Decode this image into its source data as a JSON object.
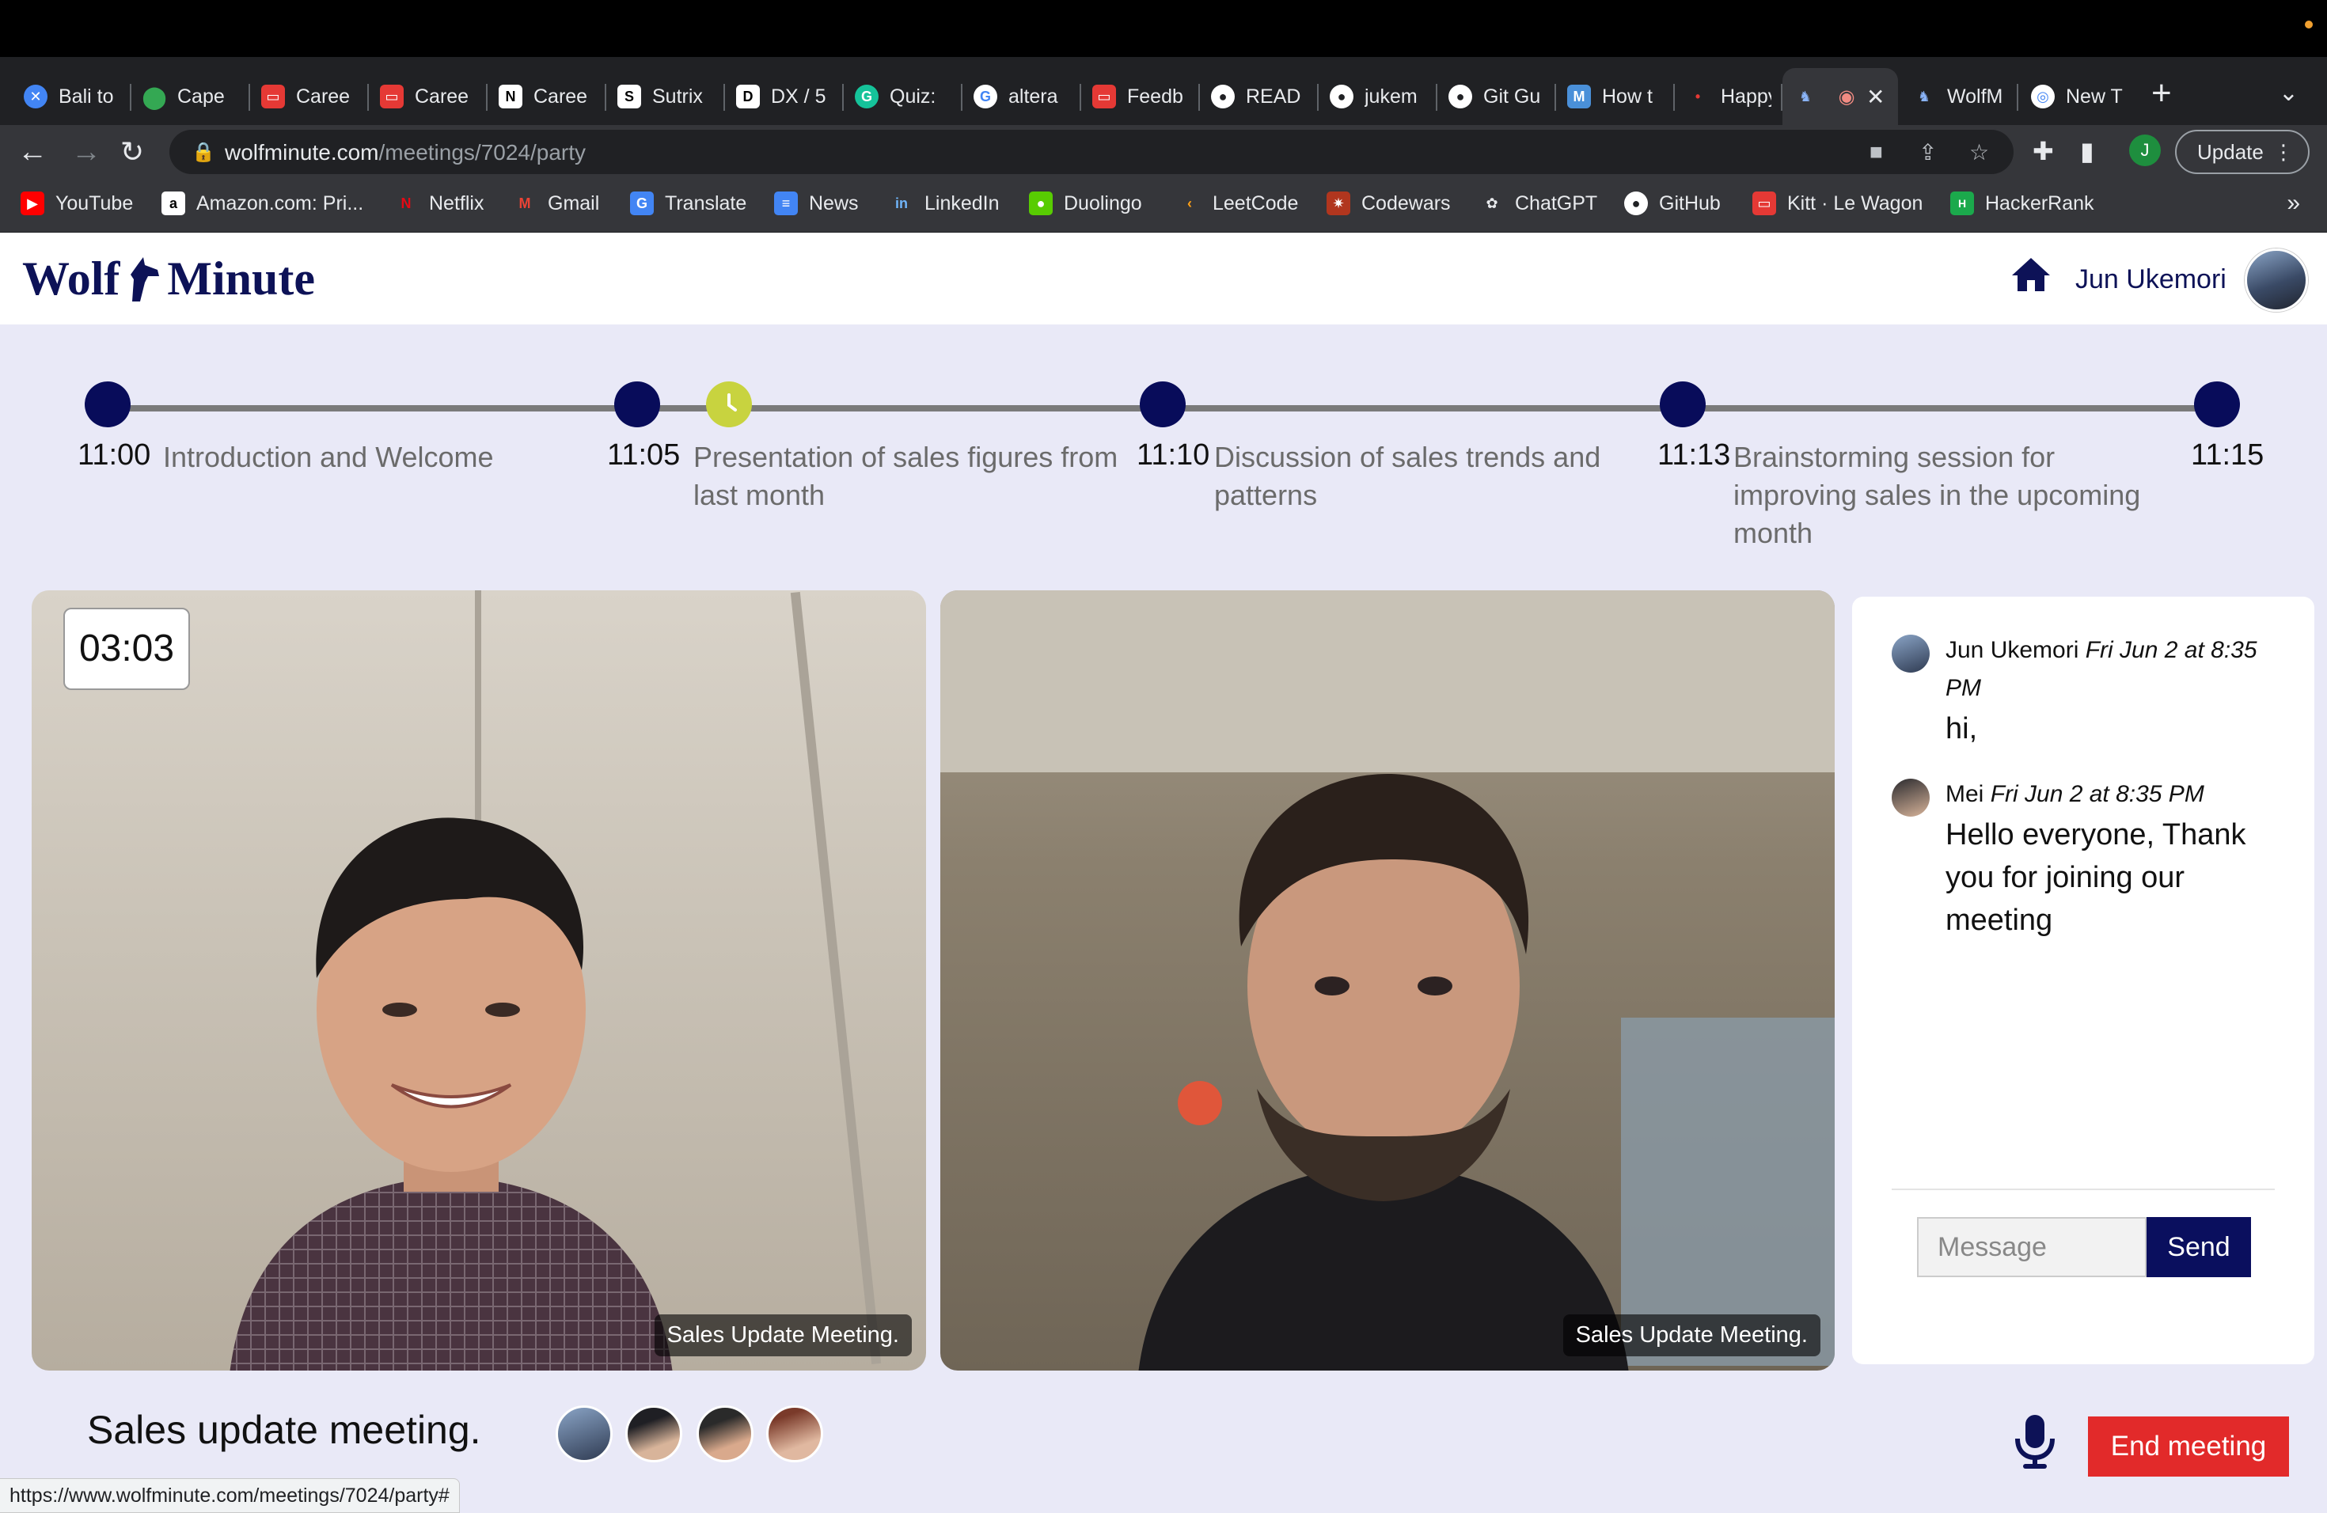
{
  "browser": {
    "tabs": [
      {
        "label": "Bali to",
        "favicon": "x-icon",
        "color": "#4285f4"
      },
      {
        "label": "Cape",
        "favicon": "maps-icon",
        "color": "#34a853"
      },
      {
        "label": "Caree",
        "favicon": "wagon-icon",
        "color": "#e53935"
      },
      {
        "label": "Caree",
        "favicon": "wagon-icon",
        "color": "#e53935"
      },
      {
        "label": "Caree",
        "favicon": "notion-icon",
        "color": "#000000"
      },
      {
        "label": "Sutrix",
        "favicon": "sutrix-icon",
        "color": "#000000"
      },
      {
        "label": "DX / 5",
        "favicon": "dx-icon",
        "color": "#000000"
      },
      {
        "label": "Quiz:",
        "favicon": "grammarly-icon",
        "color": "#15c39a"
      },
      {
        "label": "altera",
        "favicon": "google-icon",
        "color": "#ffffff"
      },
      {
        "label": "Feedb",
        "favicon": "wagon-icon",
        "color": "#e53935"
      },
      {
        "label": "READ",
        "favicon": "github-icon",
        "color": "#202124"
      },
      {
        "label": "jukem",
        "favicon": "github-icon",
        "color": "#202124"
      },
      {
        "label": "Git Gu",
        "favicon": "github-icon",
        "color": "#202124"
      },
      {
        "label": "How t",
        "favicon": "medium-icon",
        "color": "#4a90d9"
      },
      {
        "label": "Happy",
        "favicon": "happy-icon",
        "color": "#e53935"
      },
      {
        "label": "",
        "favicon": "wolfminute-icon",
        "color": "#0d1257"
      },
      {
        "label": "WolfM",
        "favicon": "wolfminute-icon",
        "color": "#0d1257"
      },
      {
        "label": "New T",
        "favicon": "chrome-icon",
        "color": "#ffffff"
      }
    ],
    "url_host": "wolfminute.com",
    "url_path": "/meetings/7024/party",
    "profile_initial": "J",
    "update_label": "Update",
    "bookmarks": [
      {
        "label": "YouTube",
        "icon": "youtube-icon",
        "color": "#ff0000"
      },
      {
        "label": "Amazon.com: Pri...",
        "icon": "amazon-icon",
        "color": "#ffffff"
      },
      {
        "label": "Netflix",
        "icon": "netflix-icon",
        "color": "#e50914"
      },
      {
        "label": "Gmail",
        "icon": "gmail-icon",
        "color": "#ea4335"
      },
      {
        "label": "Translate",
        "icon": "translate-icon",
        "color": "#4285f4"
      },
      {
        "label": "News",
        "icon": "news-icon",
        "color": "#4285f4"
      },
      {
        "label": "LinkedIn",
        "icon": "linkedin-icon",
        "color": "#0a66c2"
      },
      {
        "label": "Duolingo",
        "icon": "duolingo-icon",
        "color": "#58cc02"
      },
      {
        "label": "LeetCode",
        "icon": "leetcode-icon",
        "color": "#ffa116"
      },
      {
        "label": "Codewars",
        "icon": "codewars-icon",
        "color": "#b1361e"
      },
      {
        "label": "ChatGPT",
        "icon": "chatgpt-icon",
        "color": "#202124"
      },
      {
        "label": "GitHub",
        "icon": "github-icon",
        "color": "#202124"
      },
      {
        "label": "Kitt · Le Wagon",
        "icon": "wagon-icon",
        "color": "#e53935"
      },
      {
        "label": "HackerRank",
        "icon": "hackerrank-icon",
        "color": "#1ba94c"
      }
    ],
    "status_url": "https://www.wolfminute.com/meetings/7024/party#"
  },
  "app": {
    "logo_left": "Wolf",
    "logo_right": "Minute",
    "user_name": "Jun Ukemori",
    "brand_color": "#0d1257",
    "accent_current": "#c8d33f"
  },
  "agenda": [
    {
      "time": "11:00",
      "topic": "Introduction and Welcome",
      "status": "done"
    },
    {
      "time": "11:05",
      "topic": "Presentation of sales figures from last month",
      "status": "current"
    },
    {
      "time": "11:10",
      "topic": "Discussion of sales trends and patterns",
      "status": "upcoming"
    },
    {
      "time": "11:13",
      "topic": "Brainstorming session for improving sales in the upcoming month",
      "status": "upcoming"
    },
    {
      "time": "11:15",
      "topic": "",
      "status": "end"
    }
  ],
  "videos": {
    "timer": "03:03",
    "caption_1": "Sales Update Meeting.",
    "caption_2": "Sales Update Meeting."
  },
  "chat": {
    "messages": [
      {
        "author": "Jun Ukemori",
        "time": "Fri Jun 2 at 8:35 PM",
        "text": "hi,"
      },
      {
        "author": "Mei",
        "time": "Fri Jun 2 at 8:35 PM",
        "text": "Hello everyone, Thank you for joining our meeting"
      }
    ],
    "input_placeholder": "Message",
    "send_label": "Send"
  },
  "footer": {
    "meeting_title": "Sales update meeting.",
    "participant_count": 4,
    "end_label": "End meeting",
    "end_color": "#e22a2a"
  }
}
